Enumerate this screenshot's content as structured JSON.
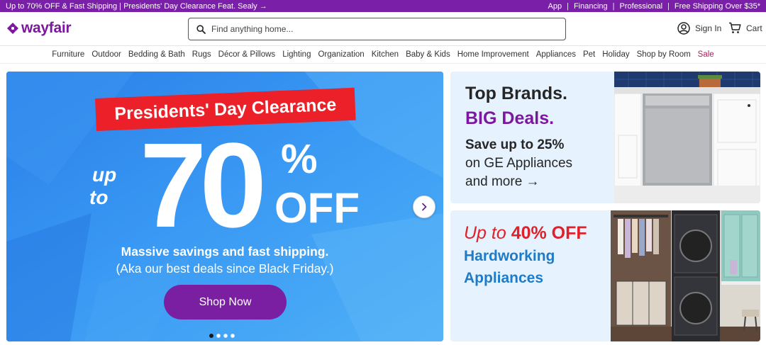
{
  "promo": {
    "left_text": "Up to 70% OFF & Fast Shipping | Presidents' Day Clearance Feat. Sealy →",
    "links": [
      "App",
      "Financing",
      "Professional",
      "Free Shipping Over $35*"
    ],
    "separator": "|",
    "bg_color": "#7a1fa8"
  },
  "header": {
    "logo_text": "wayfair",
    "logo_icon": "wayfair-logo-icon",
    "search_placeholder": "Find anything home...",
    "signin_label": "Sign In",
    "cart_label": "Cart"
  },
  "nav": {
    "items": [
      "Furniture",
      "Outdoor",
      "Bedding & Bath",
      "Rugs",
      "Décor & Pillows",
      "Lighting",
      "Organization",
      "Kitchen",
      "Baby & Kids",
      "Home Improvement",
      "Appliances",
      "Pet",
      "Holiday",
      "Shop by Room"
    ],
    "sale_label": "Sale"
  },
  "hero": {
    "ribbon": "Presidents' Day Clearance",
    "up": "up",
    "to": "to",
    "amount": "70",
    "percent": "%",
    "off": "OFF",
    "line1": "Massive savings and fast shipping.",
    "line2": "(Aka our best deals since Black Friday.)",
    "cta": "Shop Now",
    "slides_total": 4,
    "active_slide": 1
  },
  "card_brands": {
    "title": "Top Brands.",
    "big": "BIG Deals.",
    "save": "Save up to 25%",
    "sub1": "on GE Appliances",
    "sub2": "and more →"
  },
  "card_appliances": {
    "head_prefix": "Up to ",
    "head_bold": "40% OFF",
    "sub1": "Hardworking",
    "sub2": "Appliances"
  },
  "colors": {
    "brand_purple": "#7b189f",
    "hero_blue": "#2f8cf0",
    "ribbon_red": "#ec2028",
    "sale_red": "#b0205a",
    "card_bg": "#e6f2fd",
    "accent_blue": "#1f7bc7",
    "accent_red": "#e0202a"
  }
}
